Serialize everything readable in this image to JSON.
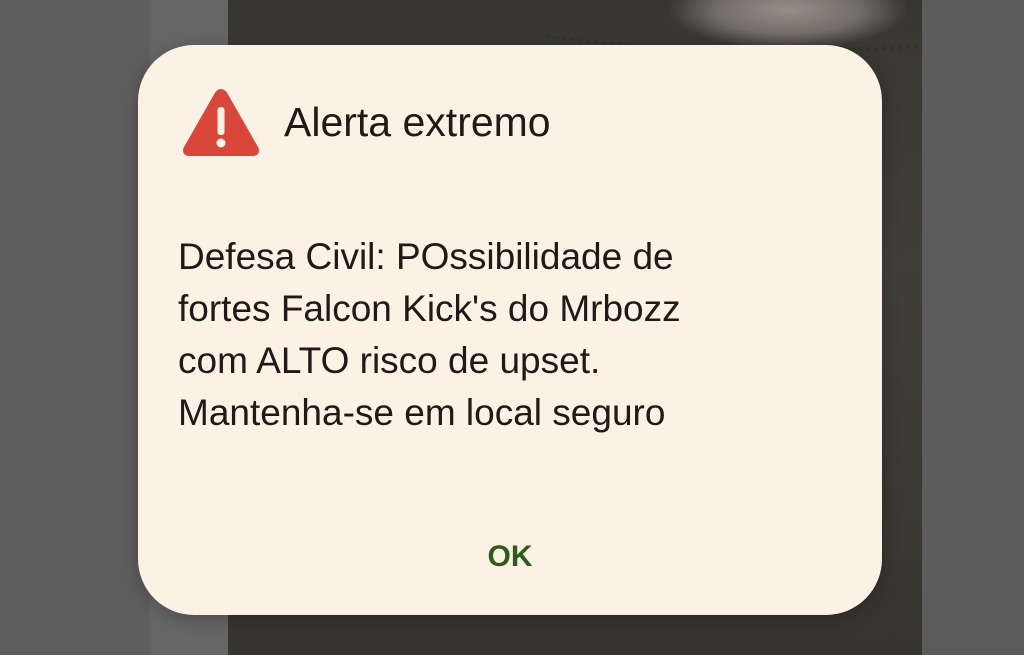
{
  "dialog": {
    "title": "Alerta extremo",
    "icon": "warning-triangle-icon",
    "icon_color": "#d9473b",
    "message_lines": [
      "Defesa Civil: POssibilidade de",
      "fortes Falcon Kick's do Mrbozz",
      "com ALTO risco de upset.",
      "Mantenha-se em local seguro"
    ],
    "ok_label": "OK",
    "ok_color": "#2f5c1b",
    "background_color": "#fbf1e5"
  }
}
